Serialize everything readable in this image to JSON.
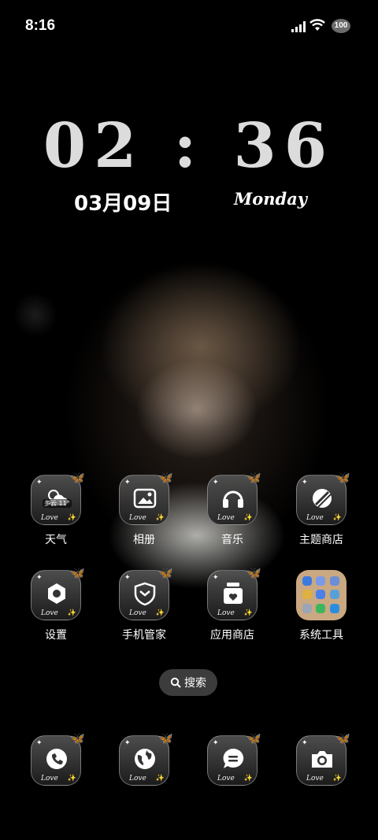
{
  "status_bar": {
    "time": "8:16",
    "battery": "100"
  },
  "clock": {
    "time": "02 : 36",
    "date": "03月09日",
    "weekday": "Monday"
  },
  "weather_badge": "多云 11°",
  "icon_decoration": {
    "love_text": "Love"
  },
  "apps": [
    {
      "label": "天气",
      "icon": "weather-icon"
    },
    {
      "label": "相册",
      "icon": "gallery-icon"
    },
    {
      "label": "音乐",
      "icon": "music-icon"
    },
    {
      "label": "主题商店",
      "icon": "theme-store-icon"
    },
    {
      "label": "设置",
      "icon": "settings-icon"
    },
    {
      "label": "手机管家",
      "icon": "phone-manager-icon"
    },
    {
      "label": "应用商店",
      "icon": "app-store-icon"
    },
    {
      "label": "系统工具",
      "icon": "folder-icon"
    }
  ],
  "search": {
    "label": "搜索"
  },
  "dock": [
    {
      "icon": "phone-icon"
    },
    {
      "icon": "browser-icon"
    },
    {
      "icon": "messages-icon"
    },
    {
      "icon": "camera-icon"
    }
  ]
}
